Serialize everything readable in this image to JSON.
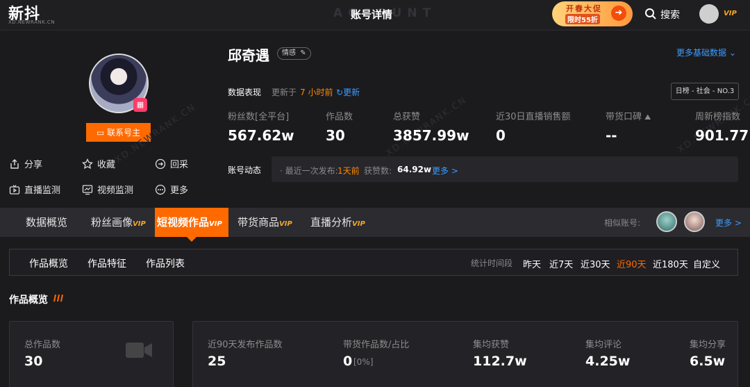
{
  "topbar": {
    "logo": "新抖",
    "logo_sub": "XD.NEWRANK.CN",
    "watermark": "ACCOUNT",
    "title": "账号详情",
    "promo_line1": "开春大促",
    "promo_line2": "限时55折",
    "search_label": "搜索",
    "vip": "VIP"
  },
  "profile": {
    "name": "邱奇遇",
    "tag": "情感",
    "contact_button": "联系号主",
    "actions": [
      "分享",
      "收藏",
      "回采",
      "直播监测",
      "视频监测",
      "更多"
    ],
    "more_basic": "更多基础数据",
    "data_perf_label": "数据表现",
    "updated_prefix": "更新于",
    "updated_time": "7 小时前",
    "refresh": "更新",
    "rank_badge": "日榜 - 社会 - NO.3",
    "stats": [
      {
        "label": "粉丝数[全平台]",
        "value": "567.62w"
      },
      {
        "label": "作品数",
        "value": "30"
      },
      {
        "label": "总获赞",
        "value": "3857.99w"
      },
      {
        "label": "近30日直播销售额",
        "value": "0"
      },
      {
        "label": "带货口碑",
        "value": "--"
      },
      {
        "label": "周新榜指数",
        "value": "901.77"
      }
    ],
    "dynamic_label": "账号动态",
    "dynamic_latest_prefix": "最近一次发布:",
    "dynamic_latest_value": "1天前",
    "dynamic_likes_prefix": "获赞数:",
    "dynamic_likes_value": "64.92w",
    "dynamic_more": "更多 >"
  },
  "tabs": {
    "items": [
      {
        "label": "数据概览",
        "vip": ""
      },
      {
        "label": "粉丝画像",
        "vip": "VIP"
      },
      {
        "label": "短视频作品",
        "vip": "VIP"
      },
      {
        "label": "带货商品",
        "vip": "VIP"
      },
      {
        "label": "直播分析",
        "vip": "VIP"
      }
    ],
    "active_index": 2,
    "similar_label": "相似账号:",
    "similar_more": "更多 >"
  },
  "subtabs": {
    "items": [
      "作品概览",
      "作品特征",
      "作品列表"
    ],
    "time_range_label": "统计时间段",
    "time_options": [
      "昨天",
      "近7天",
      "近30天",
      "近90天",
      "近180天",
      "自定义"
    ],
    "time_active_index": 3
  },
  "overview": {
    "title": "作品概览",
    "total_label": "总作品数",
    "total_value": "30",
    "stats": [
      {
        "label": "近90天发布作品数",
        "value": "25"
      },
      {
        "label": "带货作品数/占比",
        "value": "0"
      },
      {
        "label": "集均获赞",
        "value": "112.7w"
      },
      {
        "label": "集均评论",
        "value": "4.25w"
      },
      {
        "label": "集均分享",
        "value": "6.5w"
      }
    ],
    "sales_pct": "[0%]"
  },
  "colors": {
    "accent": "#ff6a00",
    "link": "#3b9cff",
    "vip": "#f5a623"
  }
}
